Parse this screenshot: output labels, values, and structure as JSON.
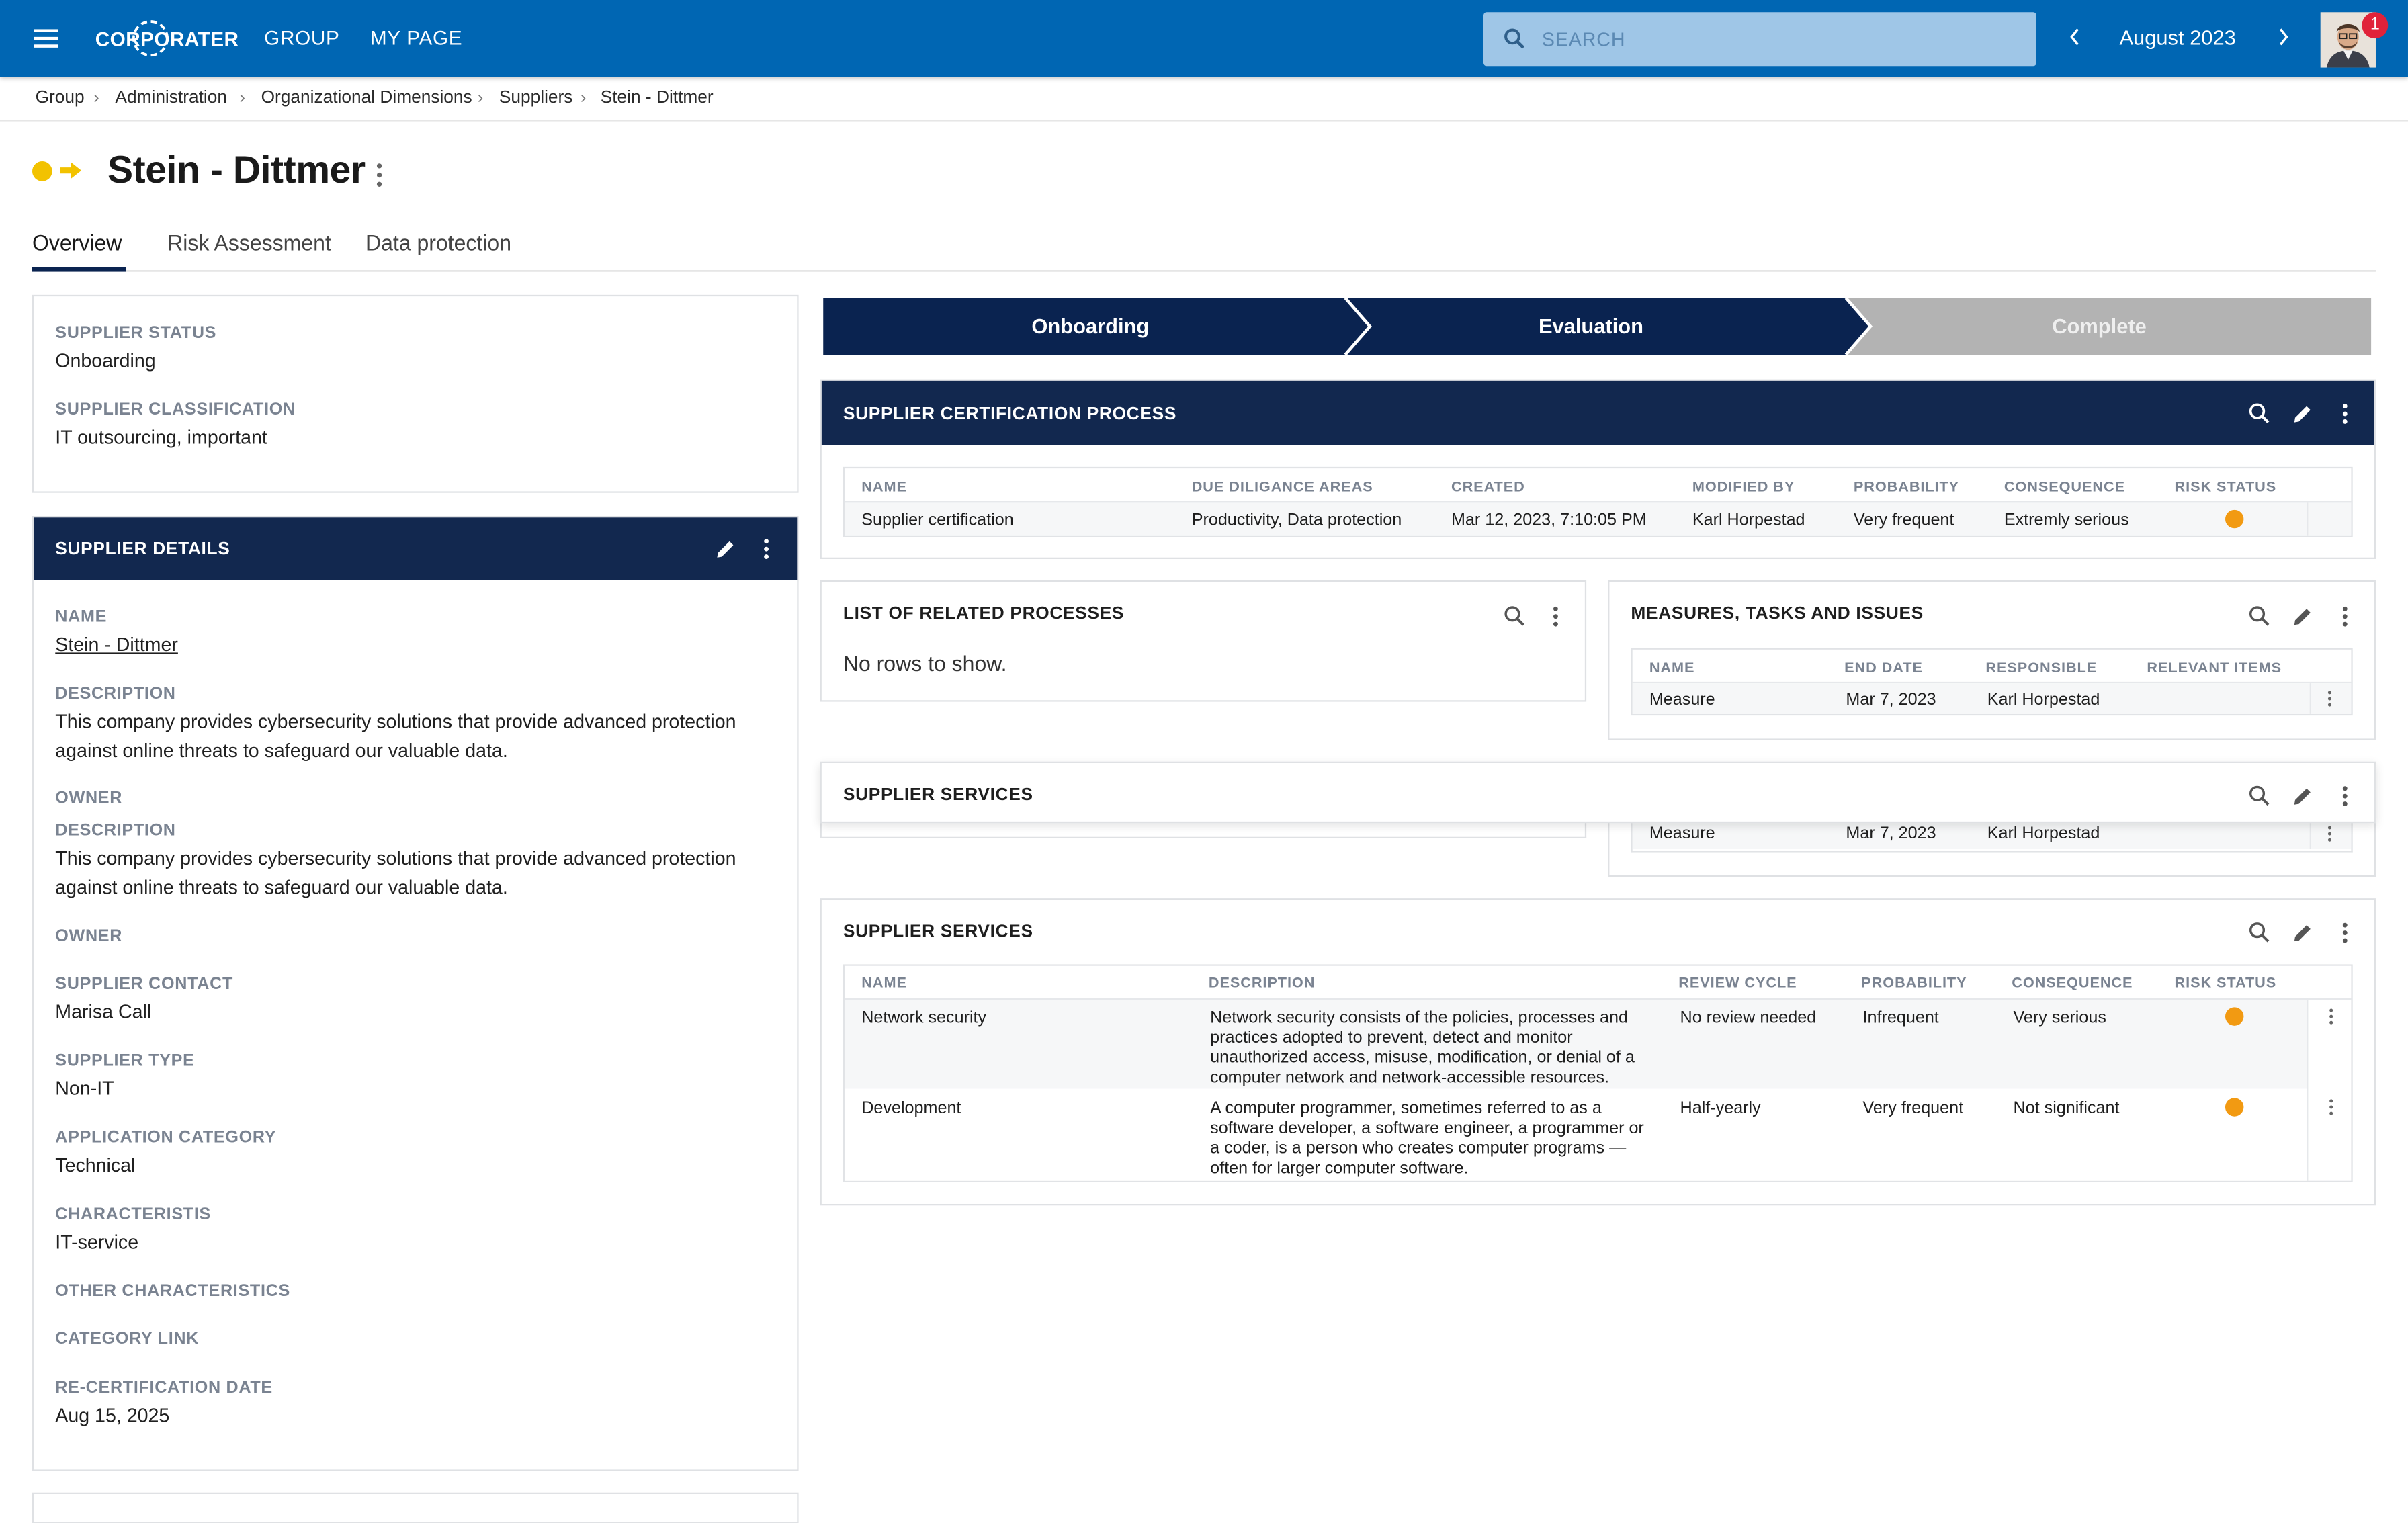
{
  "app": {
    "logo_text": "CORPORATER",
    "nav": [
      "GROUP",
      "MY PAGE"
    ],
    "search_placeholder": "SEARCH",
    "period": "August 2023",
    "notification_count": "1"
  },
  "breadcrumb": [
    "Group",
    "Administration",
    "Organizational Dimensions",
    "Suppliers",
    "Stein - Dittmer"
  ],
  "page": {
    "title": "Stein - Dittmer",
    "tabs": [
      "Overview",
      "Risk Assessment",
      "Data protection"
    ]
  },
  "summary": {
    "fields": [
      {
        "label": "SUPPLIER STATUS",
        "value": "Onboarding"
      },
      {
        "label": "SUPPLIER CLASSIFICATION",
        "value": "IT outsourcing, important"
      }
    ]
  },
  "details": {
    "title": "SUPPLIER DETAILS",
    "name_label": "NAME",
    "name_value": "Stein - Dittmer",
    "description_label": "DESCRIPTION",
    "description_value": "This company provides cybersecurity solutions that provide advanced protection against online threats to safeguard our valuable data.",
    "owner_label": "OWNER",
    "description2_label": "DESCRIPTION",
    "description2_value": "This company provides cybersecurity solutions that provide advanced protection against online threats to safeguard our valuable data.",
    "owner2_label": "OWNER",
    "contact_label": "SUPPLIER CONTACT",
    "contact_value": "Marisa Call",
    "type_label": "SUPPLIER TYPE",
    "type_value": "Non-IT",
    "appcat_label": "APPLICATION CATEGORY",
    "appcat_value": "Technical",
    "char_label": "CHARACTERISTIS",
    "char_value": "IT-service",
    "otherchar_label": "OTHER CHARACTERISTICS",
    "catlink_label": "CATEGORY LINK",
    "recert_label": "RE-CERTIFICATION DATE",
    "recert_value": "Aug 15, 2025"
  },
  "stepper": {
    "steps": [
      "Onboarding",
      "Evaluation",
      "Complete"
    ],
    "colors": {
      "done": "#0a2350",
      "pending": "#b3b3b3"
    }
  },
  "certification": {
    "title": "SUPPLIER CERTIFICATION PROCESS",
    "columns": [
      "NAME",
      "DUE DILIGANCE AREAS",
      "CREATED",
      "MODIFIED BY",
      "PROBABILITY",
      "CONSEQUENCE",
      "RISK STATUS"
    ],
    "rows": [
      {
        "name": "Supplier certification",
        "areas": "Productivity, Data protection",
        "created": "Mar 12, 2023, 7:10:05 PM",
        "modified_by": "Karl Horpestad",
        "probability": "Very frequent",
        "consequence": "Extremly serious",
        "risk_color": "#f29a12"
      }
    ]
  },
  "related": {
    "title": "LIST OF RELATED PROCESSES",
    "empty_text": "No rows to show."
  },
  "measures": {
    "title": "MEASURES, TASKS AND ISSUES",
    "columns": [
      "NAME",
      "END DATE",
      "RESPONSIBLE",
      "RELEVANT ITEMS"
    ],
    "rows": [
      {
        "name": "Measure",
        "end_date": "Mar 7, 2023",
        "responsible": "Karl Horpestad"
      }
    ],
    "ghost_row": {
      "name": "Measure",
      "end_date": "Mar 7, 2023",
      "responsible": "Karl Horpestad"
    }
  },
  "services_ghost": {
    "title": "SUPPLIER SERVICES"
  },
  "services": {
    "title": "SUPPLIER SERVICES",
    "columns": [
      "NAME",
      "DESCRIPTION",
      "REVIEW CYCLE",
      "PROBABILITY",
      "CONSEQUENCE",
      "RISK STATUS"
    ],
    "rows": [
      {
        "name": "Network security",
        "description": "Network security consists of the policies, processes and practices adopted to prevent, detect and monitor unauthorized access, misuse, modification, or denial of a computer network and network-accessible resources.",
        "review": "No review needed",
        "probability": "Infrequent",
        "consequence": "Very serious",
        "risk_color": "#f29a12"
      },
      {
        "name": "Development",
        "description": "A computer programmer, sometimes referred to as a software developer, a software engineer, a programmer or a coder, is a person who creates computer programs — often for larger computer software.",
        "review": "Half-yearly",
        "probability": "Very frequent",
        "consequence": "Not significant",
        "risk_color": "#f29a12"
      }
    ]
  },
  "colors": {
    "topbar": "#0066b3",
    "panel_header": "#12284f",
    "status_yellow": "#f2c200",
    "risk_orange": "#f29a12"
  }
}
